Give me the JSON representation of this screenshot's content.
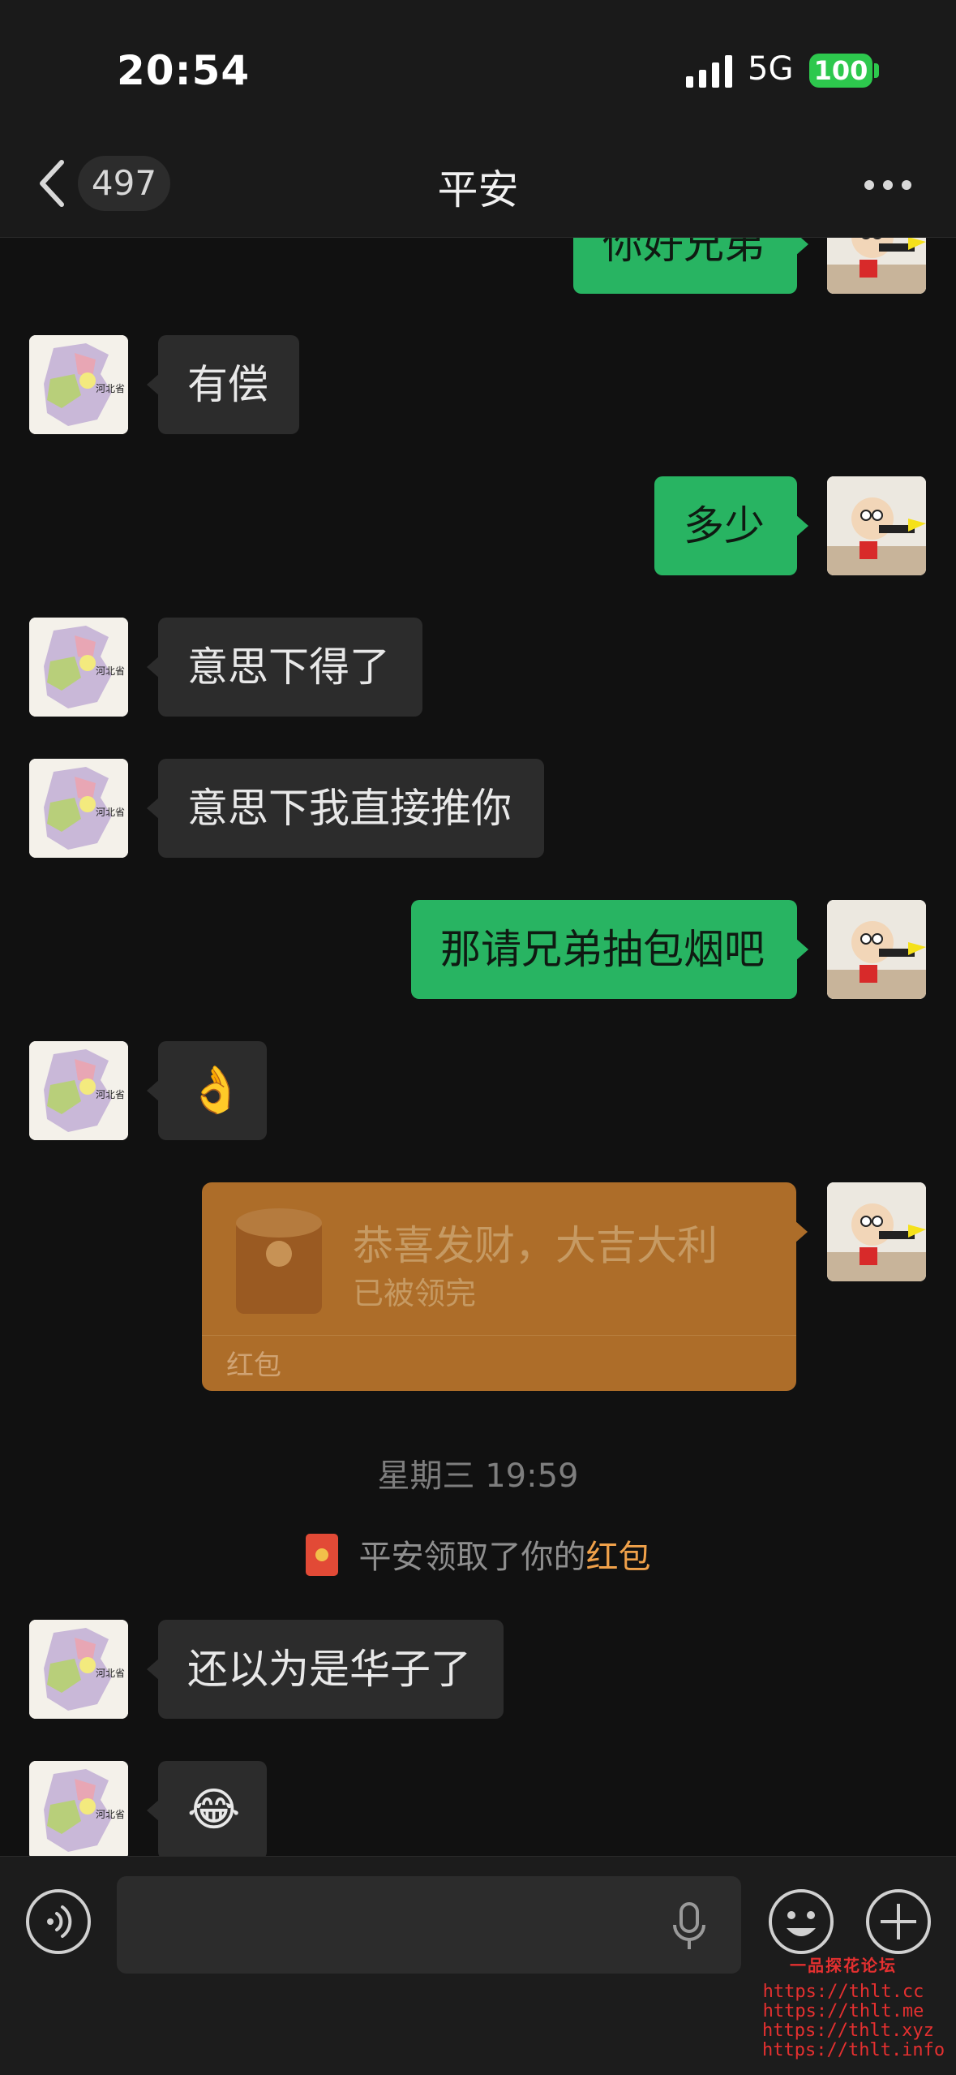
{
  "status_bar": {
    "time": "20:54",
    "network": "5G",
    "battery": "100"
  },
  "nav": {
    "unread_count": "497",
    "title": "平安"
  },
  "messages": [
    {
      "side": "out",
      "text": "你好兄弟"
    },
    {
      "side": "in",
      "text": "有偿"
    },
    {
      "side": "out",
      "text": "多少"
    },
    {
      "side": "in",
      "text": "意思下得了"
    },
    {
      "side": "in",
      "text": "意思下我直接推你"
    },
    {
      "side": "out",
      "text": "那请兄弟抽包烟吧"
    },
    {
      "side": "in",
      "emoji": "👌"
    },
    {
      "side": "out",
      "red_packet": {
        "title": "恭喜发财，大吉大利",
        "status": "已被领完",
        "label": "红包"
      }
    },
    {
      "timestamp": "星期三 19:59"
    },
    {
      "system": {
        "prefix": "平安领取了你的",
        "highlight": "红包"
      }
    },
    {
      "side": "in",
      "text": "还以为是华子了"
    },
    {
      "side": "in",
      "emoji": "😂"
    }
  ],
  "input": {
    "value": ""
  },
  "watermark": {
    "title": "一品探花论坛",
    "links": [
      "https://thlt.cc",
      "https://thlt.me",
      "https://thlt.xyz",
      "https://thlt.info"
    ]
  },
  "colors": {
    "background": "#111111",
    "incoming_bubble": "#2c2c2c",
    "outgoing_bubble": "#28b462",
    "red_packet": "#ad6d29",
    "highlight": "#f0a14a",
    "battery": "#2dc84d"
  },
  "icons": [
    "signal-icon",
    "back-chevron-icon",
    "more-icon",
    "voice-icon",
    "microphone-icon",
    "emoji-icon",
    "plus-icon",
    "red-packet-icon"
  ]
}
